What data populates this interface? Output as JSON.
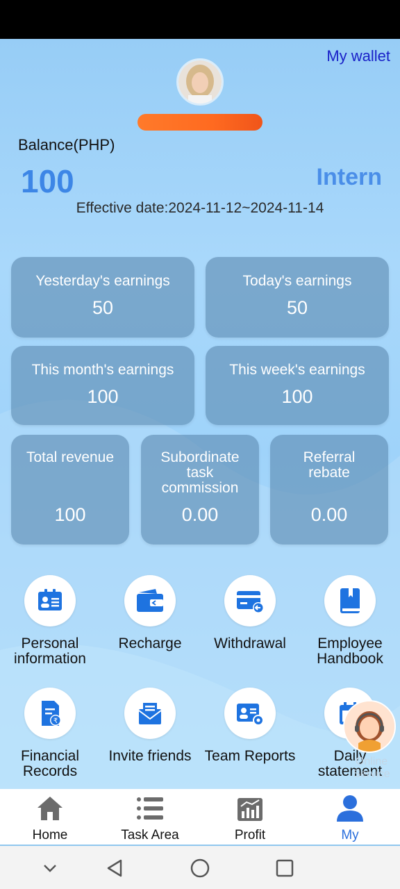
{
  "header": {
    "wallet_link": "My wallet"
  },
  "profile": {
    "balance_label": "Balance(PHP)",
    "balance_value": "100",
    "level": "Intern",
    "effective_date": "Effective date:2024-11-12~2024-11-14"
  },
  "earnings": [
    {
      "label": "Yesterday's earnings",
      "value": "50"
    },
    {
      "label": "Today's earnings",
      "value": "50"
    },
    {
      "label": "This month's earnings",
      "value": "100"
    },
    {
      "label": "This week's earnings",
      "value": "100"
    }
  ],
  "stats": [
    {
      "label": "Total revenue",
      "value": "100"
    },
    {
      "label": "Subordinate task commission",
      "value": "0.00"
    },
    {
      "label": "Referral rebate",
      "value": "0.00"
    }
  ],
  "menu": [
    {
      "label": "Personal information",
      "icon": "id-card-icon"
    },
    {
      "label": "Recharge",
      "icon": "wallet-icon"
    },
    {
      "label": "Withdrawal",
      "icon": "card-withdraw-icon"
    },
    {
      "label": "Employee Handbook",
      "icon": "book-icon"
    },
    {
      "label": "Financial Records",
      "icon": "document-rupee-icon"
    },
    {
      "label": "Invite friends",
      "icon": "envelope-icon"
    },
    {
      "label": "Team Reports",
      "icon": "team-settings-icon"
    },
    {
      "label": "Daily statement",
      "icon": "calendar-icon"
    }
  ],
  "customer_service": {
    "label": "Online Service"
  },
  "tabs": [
    {
      "label": "Home",
      "icon": "home-icon"
    },
    {
      "label": "Task Area",
      "icon": "list-icon"
    },
    {
      "label": "Profit",
      "icon": "chart-icon"
    },
    {
      "label": "My",
      "icon": "user-icon"
    }
  ],
  "colors": {
    "accent": "#2b6fdc",
    "balance": "#3d86e6",
    "wallet_link": "#1a22c8",
    "card_bg": "#5482a8"
  }
}
